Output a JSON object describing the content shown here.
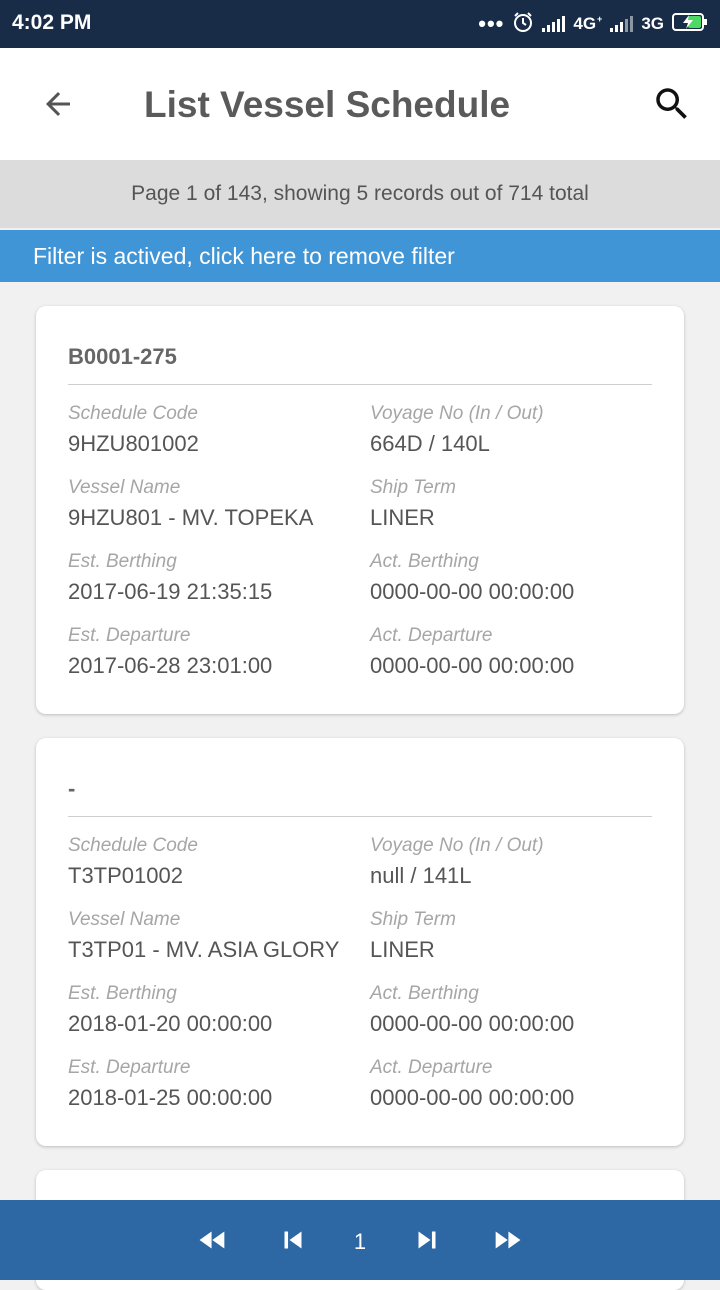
{
  "status_bar": {
    "time": "4:02 PM",
    "dots": "•••",
    "network_1": "4G",
    "network_1_sub": "+",
    "network_2": "3G",
    "icons": [
      "alarm-icon",
      "signal-icon",
      "battery-charging-icon"
    ]
  },
  "header": {
    "title": "List Vessel Schedule",
    "back_icon": "arrow-back-icon",
    "search_icon": "search-icon"
  },
  "page_info": "Page 1 of 143, showing 5 records out of 714 total",
  "filter_bar": "Filter is actived, click here to remove filter",
  "colors": {
    "status_bar_bg": "#192c47",
    "filter_bar_bg": "#3f95d6",
    "pagination_bg": "#2d68a4",
    "page_info_bg": "#dcdcdc"
  },
  "labels": {
    "schedule_code": "Schedule Code",
    "voyage_no": "Voyage No (In / Out)",
    "vessel_name": "Vessel Name",
    "ship_term": "Ship Term",
    "est_berthing": "Est. Berthing",
    "act_berthing": "Act. Berthing",
    "est_departure": "Est. Departure",
    "act_departure": "Act. Departure"
  },
  "records": [
    {
      "code": "B0001-275",
      "schedule_code": "9HZU801002",
      "voyage_no": "664D / 140L",
      "vessel_name": "9HZU801 - MV. TOPEKA",
      "ship_term": "LINER",
      "est_berthing": "2017-06-19 21:35:15",
      "act_berthing": "0000-00-00 00:00:00",
      "est_departure": "2017-06-28 23:01:00",
      "act_departure": "0000-00-00 00:00:00"
    },
    {
      "code": "-",
      "schedule_code": "T3TP01002",
      "voyage_no": "null / 141L",
      "vessel_name": "T3TP01 - MV. ASIA GLORY",
      "ship_term": "LINER",
      "est_berthing": "2018-01-20 00:00:00",
      "act_berthing": "0000-00-00 00:00:00",
      "est_departure": "2018-01-25 00:00:00",
      "act_departure": "0000-00-00 00:00:00"
    }
  ],
  "pagination": {
    "current_page": "1",
    "first_icon": "fast-rewind-icon",
    "prev_icon": "skip-previous-icon",
    "next_icon": "skip-next-icon",
    "last_icon": "fast-forward-icon"
  }
}
